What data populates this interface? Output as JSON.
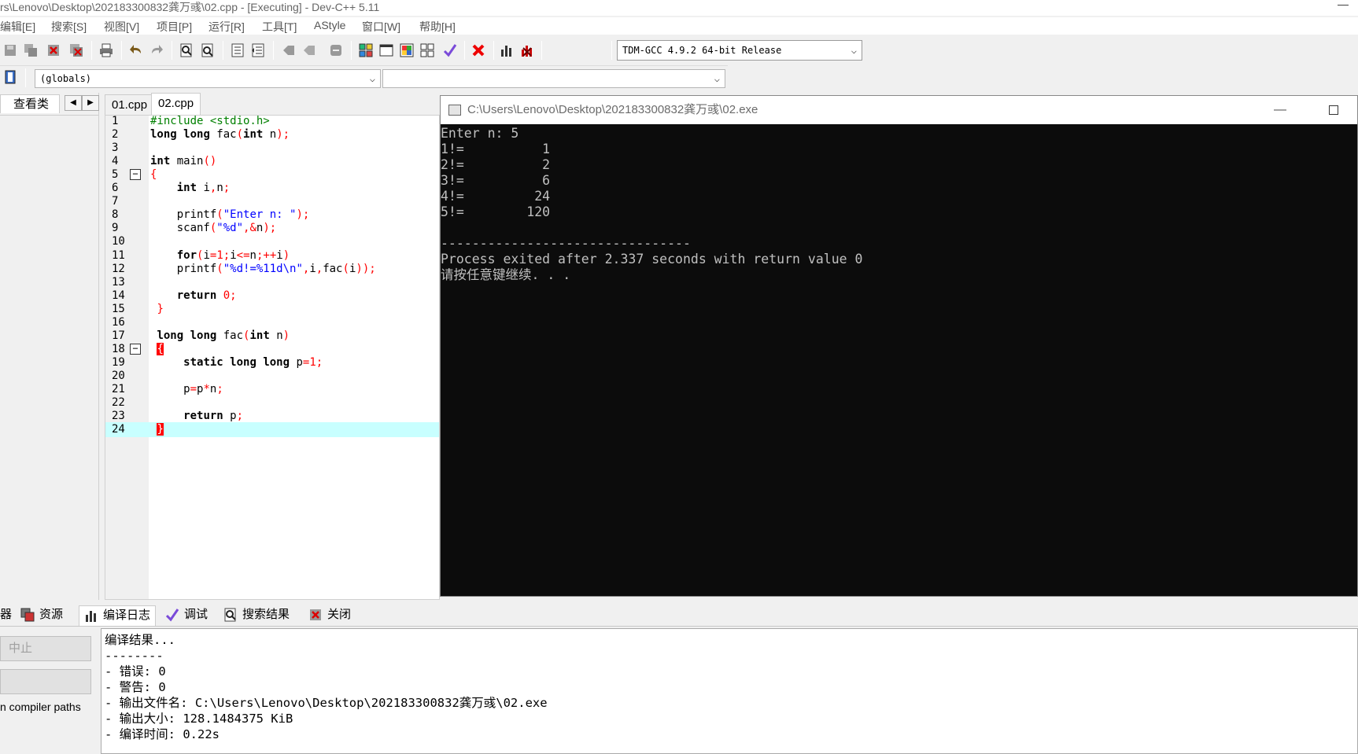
{
  "window": {
    "title": "rs\\Lenovo\\Desktop\\202183300832龚万彧\\02.cpp - [Executing] - Dev-C++ 5.11",
    "minimize_glyph": "—"
  },
  "menu": [
    "编辑[E]",
    "搜索[S]",
    "视图[V]",
    "项目[P]",
    "运行[R]",
    "工具[T]",
    "AStyle",
    "窗口[W]",
    "帮助[H]"
  ],
  "toolbar": {
    "compiler": "TDM-GCC 4.9.2 64-bit Release"
  },
  "toolbar2": {
    "scope": "(globals)",
    "member": ""
  },
  "left_panel": {
    "tab": "查看类"
  },
  "editor": {
    "tabs": [
      "01.cpp",
      "02.cpp"
    ],
    "active_tab": "02.cpp",
    "lines": [
      "#include <stdio.h>",
      "long long fac(int n);",
      "",
      "int main()",
      "{",
      "    int i,n;",
      "",
      "    printf(\"Enter n: \");",
      "    scanf(\"%d\",&n);",
      "",
      "    for(i=1;i<=n;++i)",
      "    printf(\"%d!=%11d\\n\",i,fac(i));",
      "",
      "    return 0;",
      " }",
      "",
      " long long fac(int n)",
      " {",
      "     static long long p=1;",
      "",
      "     p=p*n;",
      "",
      "     return p;",
      " }"
    ]
  },
  "console": {
    "title": "C:\\Users\\Lenovo\\Desktop\\202183300832龚万彧\\02.exe",
    "lines": [
      "Enter n: 5",
      "1!=          1",
      "2!=          2",
      "3!=          6",
      "4!=         24",
      "5!=        120",
      "",
      "--------------------------------",
      "Process exited after 2.337 seconds with return value 0",
      "请按任意键继续. . ."
    ]
  },
  "bottom_tabs": [
    "器",
    "资源",
    "编译日志",
    "调试",
    "搜索结果",
    "关闭"
  ],
  "bottom_left": {
    "abort_button": "中止",
    "compiler_paths_label": "n compiler paths"
  },
  "compile_log": [
    "编译结果...",
    "--------",
    "- 错误: 0",
    "- 警告: 0",
    "- 输出文件名: C:\\Users\\Lenovo\\Desktop\\202183300832龚万彧\\02.exe",
    "- 输出大小: 128.1484375 KiB",
    "- 编译时间: 0.22s"
  ]
}
